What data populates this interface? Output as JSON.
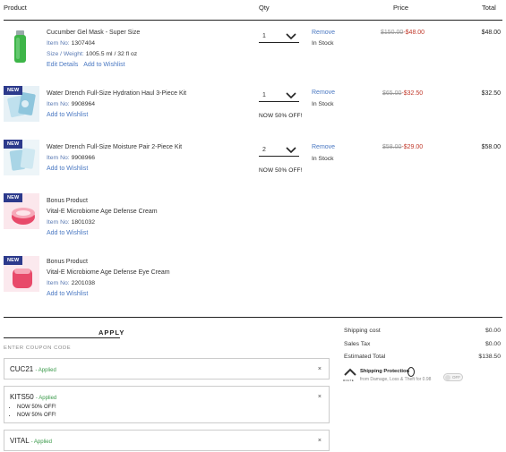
{
  "header": {
    "product": "Product",
    "qty": "Qty",
    "price": "Price",
    "total": "Total"
  },
  "badge_new": "NEW",
  "items": [
    {
      "name": "Cucumber Gel Mask - Super Size",
      "item_no_label": "Item No:",
      "item_no": "1307404",
      "size_label": "Size / Weight:",
      "size": "1005.5 ml / 32 fl oz",
      "edit": "Edit Details",
      "wishlist": "Add to Wishlist",
      "qty": "1",
      "remove": "Remove",
      "stock": "In Stock",
      "price_old": "$150.00",
      "price_sep": "-",
      "price_new": "$48.00",
      "total": "$48.00"
    },
    {
      "name": "Water Drench Full-Size Hydration Haul 3-Piece Kit",
      "item_no_label": "Item No:",
      "item_no": "9908964",
      "wishlist": "Add to Wishlist",
      "qty": "1",
      "remove": "Remove",
      "stock": "In Stock",
      "promo": "NOW 50% OFF!",
      "price_old": "$65.00",
      "price_sep": "-",
      "price_new": "$32.50",
      "total": "$32.50"
    },
    {
      "name": "Water Drench Full-Size Moisture Pair 2-Piece Kit",
      "item_no_label": "Item No:",
      "item_no": "9908966",
      "wishlist": "Add to Wishlist",
      "qty": "2",
      "remove": "Remove",
      "stock": "In Stock",
      "promo": "NOW 50% OFF!",
      "price_old": "$58.00",
      "price_sep": "-",
      "price_new": "$29.00",
      "total": "$58.00"
    },
    {
      "bonus": "Bonus Product",
      "name": "Vital-E Microbiome Age Defense Cream",
      "item_no_label": "Item No:",
      "item_no": "1801032",
      "wishlist": "Add to Wishlist"
    },
    {
      "bonus": "Bonus Product",
      "name": "Vital-E Microbiome Age Defense Eye Cream",
      "item_no_label": "Item No:",
      "item_no": "2201038",
      "wishlist": "Add to Wishlist"
    }
  ],
  "coupon": {
    "apply": "APPLY",
    "placeholder": "ENTER COUPON CODE",
    "codes": [
      {
        "code": "CUC21",
        "status": "- Applied",
        "remove": "×"
      },
      {
        "code": "KITS50",
        "status": "- Applied",
        "remove": "×",
        "notes": [
          "NOW 50% OFF!",
          "NOW 50% OFF!"
        ]
      },
      {
        "code": "VITAL",
        "status": "- Applied",
        "remove": "×"
      }
    ]
  },
  "summary": {
    "shipping_label": "Shipping cost",
    "shipping": "$0.00",
    "tax_label": "Sales Tax",
    "tax": "$0.00",
    "total_label": "Estimated Total",
    "total": "$138.50",
    "protection_title": "Shipping Protection",
    "protection_desc": "from Damage, Loss & Theft for 0.98",
    "route_logo": "ROUTE",
    "toggle": "OFF"
  },
  "colors": {
    "accent_blue": "#4a78c2",
    "sale_red": "#c0392b",
    "badge_navy": "#2c3a8c",
    "applied_green": "#3a9a4a"
  }
}
